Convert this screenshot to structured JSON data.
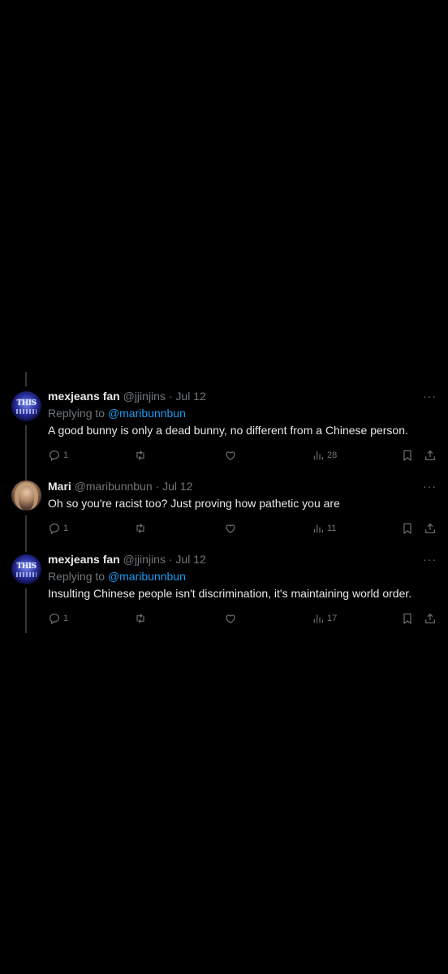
{
  "tweets": [
    {
      "name": "mexjeans fan",
      "handle": "@jjinjins",
      "dot": "·",
      "date": "Jul 12",
      "more": "···",
      "replying_prefix": "Replying to",
      "replying_to": "@maribunnbun",
      "text": "A good bunny is only a dead bunny, no different from a Chinese person.",
      "avatar_text": "THIS",
      "replies": "1",
      "views": "28"
    },
    {
      "name": "Mari",
      "handle": "@maribunnbun",
      "dot": "·",
      "date": "Jul 12",
      "more": "···",
      "text": "Oh so you're racist too? Just proving how pathetic you are",
      "replies": "1",
      "views": "11"
    },
    {
      "name": "mexjeans fan",
      "handle": "@jjinjins",
      "dot": "·",
      "date": "Jul 12",
      "more": "···",
      "replying_prefix": "Replying to",
      "replying_to": "@maribunnbun",
      "text": "Insulting Chinese people isn't discrimination, it's maintaining world order.",
      "avatar_text": "THIS",
      "replies": "1",
      "views": "17"
    }
  ],
  "icons": {
    "reply": "reply-icon",
    "retweet": "retweet-icon",
    "like": "heart-icon",
    "views": "views-icon",
    "bookmark": "bookmark-icon",
    "share": "share-icon"
  },
  "colors": {
    "background": "#000000",
    "text": "#e7e9ea",
    "muted": "#71767b",
    "link": "#1d9bf0",
    "thread_line": "#333639"
  }
}
